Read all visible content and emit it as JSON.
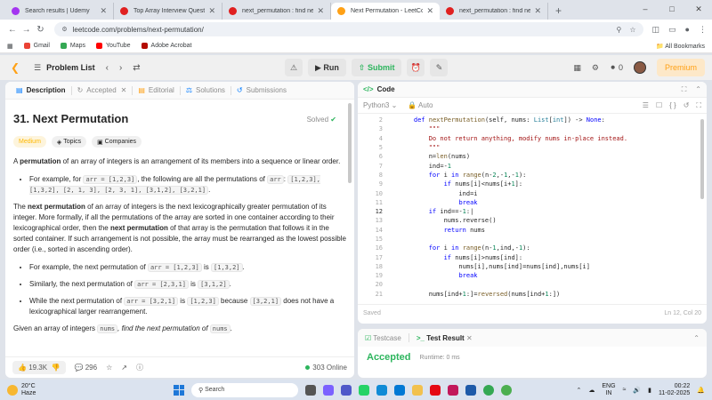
{
  "browser": {
    "tabs": [
      {
        "title": "Search results | Udemy",
        "favicon_color": "#a435f0"
      },
      {
        "title": "Top Array Interview Questions",
        "favicon_color": "#e02020"
      },
      {
        "title": "next_permutation : find next le...",
        "favicon_color": "#e02020"
      },
      {
        "title": "Next Permutation - LeetCode",
        "favicon_color": "#ffa116"
      },
      {
        "title": "next_permutation : find next le...",
        "favicon_color": "#e02020"
      }
    ],
    "url": "leetcode.com/problems/next-permutation/",
    "bookmarks": [
      {
        "label": "Gmail",
        "color": "#ea4335"
      },
      {
        "label": "Maps",
        "color": "#34a853"
      },
      {
        "label": "YouTube",
        "color": "#ff0000"
      },
      {
        "label": "Adobe Acrobat",
        "color": "#b30b00"
      }
    ],
    "all_bookmarks": "All Bookmarks"
  },
  "nav": {
    "problem_list": "Problem List",
    "run": "Run",
    "submit": "Submit",
    "fire_count": "0",
    "premium": "Premium"
  },
  "left_tabs": {
    "description": "Description",
    "accepted": "Accepted",
    "editorial": "Editorial",
    "solutions": "Solutions",
    "submissions": "Submissions"
  },
  "problem": {
    "title": "31. Next Permutation",
    "solved": "Solved",
    "difficulty": "Medium",
    "topics": "Topics",
    "companies": "Companies",
    "p1_a": "A ",
    "p1_b": "permutation",
    "p1_c": " of an array of integers is an arrangement of its members into a sequence or linear order.",
    "b1_a": "For example, for ",
    "b1_code1": "arr = [1,2,3]",
    "b1_b": ", the following are all the permutations of ",
    "b1_code2": "arr",
    "b1_c": ": ",
    "b1_code3": "[1,2,3], [1,3,2], [2, 1, 3], [2, 3, 1], [3,1,2], [3,2,1]",
    "b1_d": ".",
    "p2_a": "The ",
    "p2_b": "next permutation",
    "p2_c": " of an array of integers is the next lexicographically greater permutation of its integer. More formally, if all the permutations of the array are sorted in one container according to their lexicographical order, then the ",
    "p2_d": "next permutation",
    "p2_e": " of that array is the permutation that follows it in the sorted container. If such arrangement is not possible, the array must be rearranged as the lowest possible order (i.e., sorted in ascending order).",
    "b2_a": "For example, the next permutation of ",
    "b2_code1": "arr = [1,2,3]",
    "b2_b": " is ",
    "b2_code2": "[1,3,2]",
    "b2_c": ".",
    "b3_a": "Similarly, the next permutation of ",
    "b3_code1": "arr = [2,3,1]",
    "b3_b": " is ",
    "b3_code2": "[3,1,2]",
    "b3_c": ".",
    "b4_a": "While the next permutation of ",
    "b4_code1": "arr = [3,2,1]",
    "b4_b": " is ",
    "b4_code2": "[1,2,3]",
    "b4_c": " because ",
    "b4_code3": "[3,2,1]",
    "b4_d": " does not have a lexicographical larger rearrangement.",
    "p3_a": "Given an array of integers ",
    "p3_code": "nums",
    "p3_b": ", find the next permutation of ",
    "p3_code2": "nums",
    "p3_c": "."
  },
  "footer": {
    "likes": "19.3K",
    "comments": "296",
    "online": "303 Online"
  },
  "code_panel": {
    "title": "Code",
    "language": "Python3",
    "auto": "Auto",
    "saved": "Saved",
    "cursor": "Ln 12, Col 20"
  },
  "code_lines": [
    {
      "n": "2",
      "html": "    <span class='kw'>def</span> <span class='fn'>nextPermutation</span>(self, nums: <span class='ty'>List</span>[<span class='ty'>int</span>]) -> <span class='kw'>None</span>:"
    },
    {
      "n": "3",
      "html": "        <span class='st'>\"\"\"</span>"
    },
    {
      "n": "4",
      "html": "        <span class='st'>Do not return anything, modify nums in-place instead.</span>"
    },
    {
      "n": "5",
      "html": "        <span class='st'>\"\"\"</span>"
    },
    {
      "n": "6",
      "html": "        n=<span class='fn'>len</span>(nums)"
    },
    {
      "n": "7",
      "html": "        ind=-<span class='nu'>1</span>"
    },
    {
      "n": "8",
      "html": "        <span class='kw'>for</span> i <span class='kw'>in</span> <span class='fn'>range</span>(n-<span class='nu'>2</span>,-<span class='nu'>1</span>,-<span class='nu'>1</span>):"
    },
    {
      "n": "9",
      "html": "            <span class='kw'>if</span> nums[i]&lt;nums[i+<span class='nu'>1</span>]:"
    },
    {
      "n": "10",
      "html": "                ind=i"
    },
    {
      "n": "11",
      "html": "                <span class='kw'>break</span>"
    },
    {
      "n": "12",
      "html": "        <span class='kw'>if</span> ind==-<span class='nu'>1</span>:|"
    },
    {
      "n": "13",
      "html": "            nums.reverse()"
    },
    {
      "n": "14",
      "html": "            <span class='kw'>return</span> nums"
    },
    {
      "n": "15",
      "html": ""
    },
    {
      "n": "16",
      "html": "        <span class='kw'>for</span> i <span class='kw'>in</span> <span class='fn'>range</span>(n-<span class='nu'>1</span>,ind,-<span class='nu'>1</span>):"
    },
    {
      "n": "17",
      "html": "            <span class='kw'>if</span> nums[i]&gt;nums[ind]:"
    },
    {
      "n": "18",
      "html": "                nums[i],nums[ind]=nums[ind],nums[i]"
    },
    {
      "n": "19",
      "html": "                <span class='kw'>break</span>"
    },
    {
      "n": "20",
      "html": ""
    },
    {
      "n": "21",
      "html": "        nums[ind+<span class='nu'>1</span>:]=<span class='fn'>reversed</span>(nums[ind+<span class='nu'>1</span>:])"
    }
  ],
  "bottom_panel": {
    "testcase": "Testcase",
    "test_result": "Test Result",
    "status": "Accepted",
    "runtime": "Runtime: 0 ms"
  },
  "taskbar": {
    "temp": "20°C",
    "weather": "Haze",
    "search": "Search",
    "lang1": "ENG",
    "lang2": "IN",
    "time": "00:22",
    "date": "11-02-2025"
  }
}
